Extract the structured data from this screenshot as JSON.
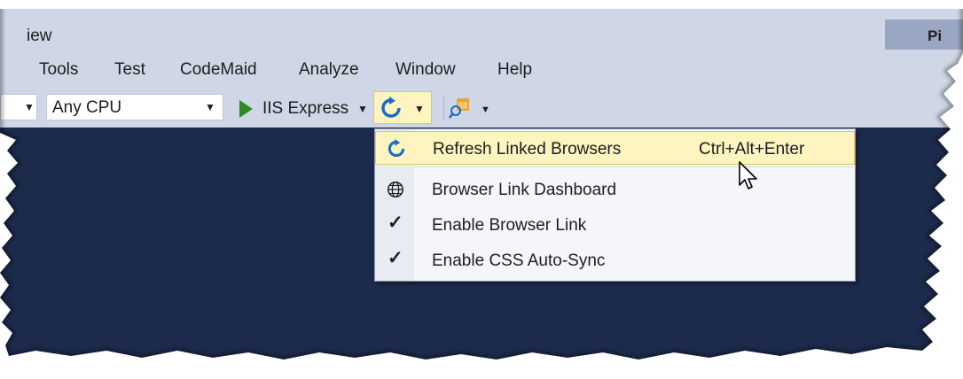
{
  "colors": {
    "chrome": "#cfd6e5",
    "editor_dark": "#1c2a4c",
    "highlight": "#fdf4bf",
    "accent_blue": "#1b6ac9",
    "play_green": "#2e8b1f"
  },
  "title": {
    "fragment": "iew",
    "preview_badge": "Pi"
  },
  "menubar": {
    "items": [
      {
        "label": "Tools"
      },
      {
        "label": "Test"
      },
      {
        "label": "CodeMaid"
      },
      {
        "label": "Analyze"
      },
      {
        "label": "Window"
      },
      {
        "label": "Help"
      }
    ]
  },
  "toolbar": {
    "platform_combo": "Any CPU",
    "run_target": "IIS Express",
    "refresh_icon": "refresh-icon",
    "browserlink_icon": "browser-link-icon"
  },
  "dropdown_menu": {
    "items": [
      {
        "label": "Refresh Linked Browsers",
        "shortcut": "Ctrl+Alt+Enter",
        "icon": "refresh-icon",
        "highlighted": true
      },
      {
        "label": "Browser Link Dashboard",
        "icon": "globe-icon"
      },
      {
        "label": "Enable Browser Link",
        "checked": true
      },
      {
        "label": "Enable CSS Auto-Sync",
        "checked": true
      }
    ]
  }
}
